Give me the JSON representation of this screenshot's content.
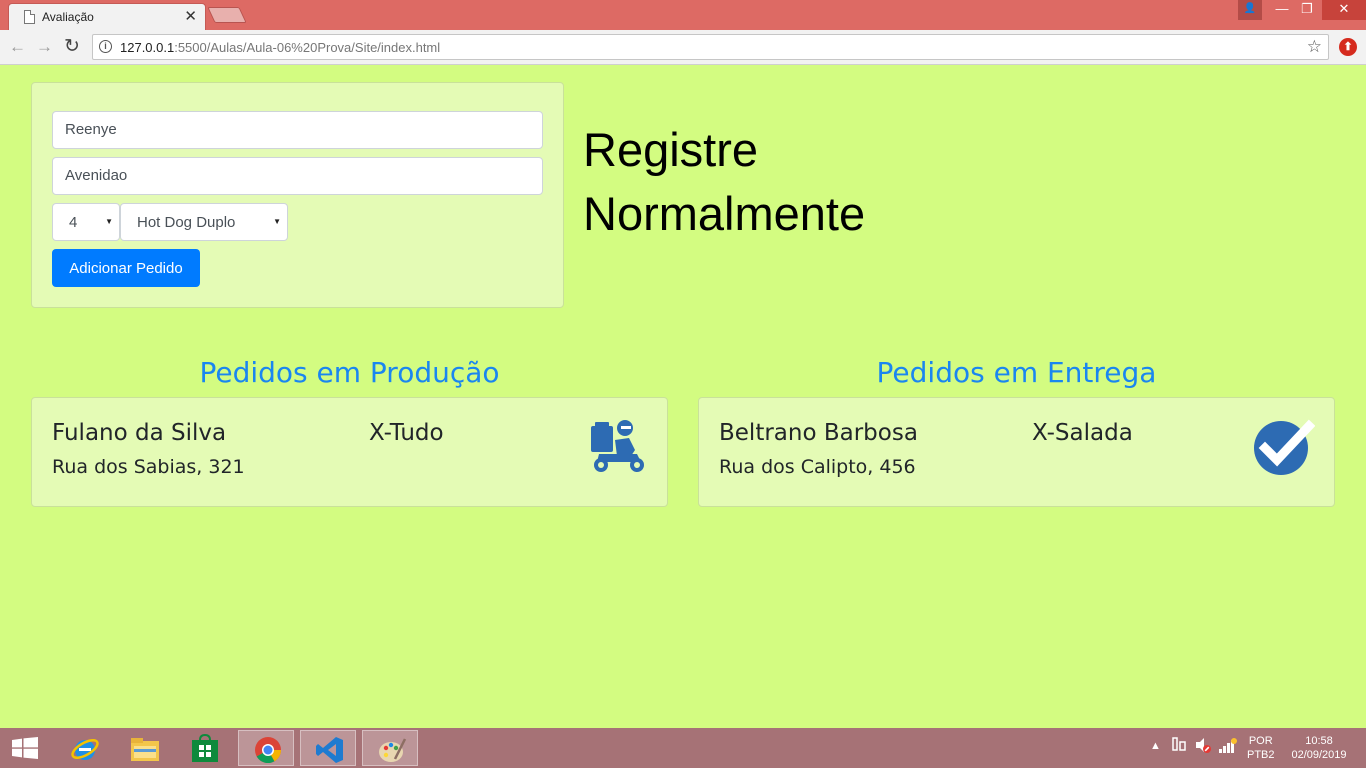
{
  "browser": {
    "tab_title": "Avaliação",
    "url_host": "127.0.0.1",
    "url_path": ":5500/Aulas/Aula-06%20Prova/Site/index.html"
  },
  "form": {
    "name_value": "Reenye",
    "address_value": "Avenidao",
    "quantity_value": "4",
    "item_value": "Hot Dog Duplo",
    "submit_label": "Adicionar Pedido"
  },
  "headline": "Registre Normalmente",
  "production": {
    "title": "Pedidos em Produção",
    "orders": [
      {
        "customer": "Fulano da Silva",
        "item": "X-Tudo",
        "address": "Rua dos Sabias, 321",
        "icon": "delivery-scooter-icon"
      }
    ]
  },
  "delivery": {
    "title": "Pedidos em Entrega",
    "orders": [
      {
        "customer": "Beltrano Barbosa",
        "item": "X-Salada",
        "address": "Rua dos Calipto, 456",
        "icon": "check-circle-icon"
      }
    ]
  },
  "taskbar": {
    "apps": [
      "ie-icon",
      "file-explorer-icon",
      "store-icon",
      "chrome-icon",
      "vscode-icon",
      "paint-icon"
    ],
    "lang_top": "POR",
    "lang_bottom": "PTB2",
    "time": "10:58",
    "date": "02/09/2019"
  },
  "colors": {
    "page_bg": "#d3fc81",
    "card_bg": "#e4fbb5",
    "primary": "#007bff",
    "section_title": "#1a86f0",
    "icon_blue": "#2d6bb3"
  }
}
